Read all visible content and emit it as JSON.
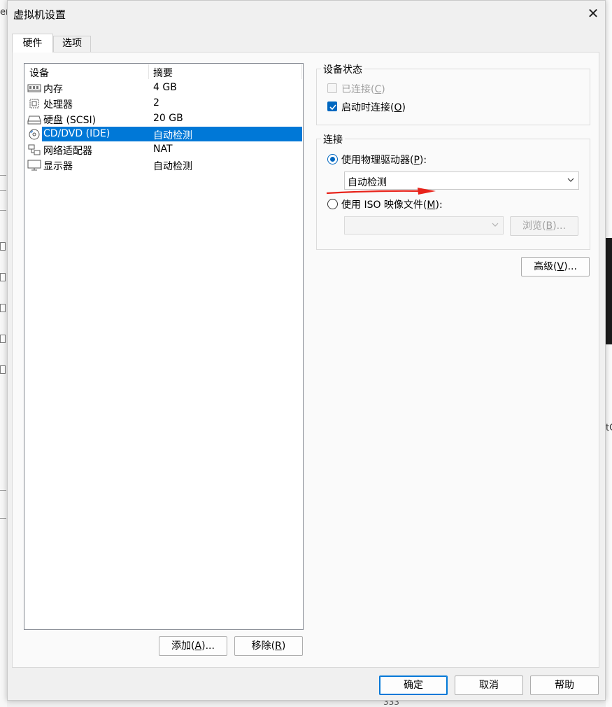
{
  "window": {
    "title": "虚拟机设置",
    "close_glyph": "✕"
  },
  "background": {
    "peek_top": "er",
    "peek_mid": "tC",
    "peek_bottom": "333"
  },
  "tabs": [
    {
      "label": "硬件",
      "active": true
    },
    {
      "label": "选项",
      "active": false
    }
  ],
  "device_list": {
    "columns": [
      "设备",
      "摘要"
    ],
    "rows": [
      {
        "icon": "memory-icon",
        "name": "内存",
        "summary": "4 GB",
        "selected": false
      },
      {
        "icon": "processor-icon",
        "name": "处理器",
        "summary": "2",
        "selected": false
      },
      {
        "icon": "hard-disk-icon",
        "name": "硬盘 (SCSI)",
        "summary": "20 GB",
        "selected": false
      },
      {
        "icon": "cd-dvd-icon",
        "name": "CD/DVD (IDE)",
        "summary": "自动检测",
        "selected": true
      },
      {
        "icon": "network-adapter-icon",
        "name": "网络适配器",
        "summary": "NAT",
        "selected": false
      },
      {
        "icon": "display-icon",
        "name": "显示器",
        "summary": "自动检测",
        "selected": false
      }
    ]
  },
  "list_buttons": {
    "add": {
      "label": "添加(",
      "key": "A",
      "suffix": ")..."
    },
    "remove": {
      "label": "移除(",
      "key": "R",
      "suffix": ")"
    }
  },
  "device_status": {
    "title": "设备状态",
    "connected": {
      "label": "已连接(",
      "key": "C",
      "suffix": ")",
      "checked": false,
      "enabled": false
    },
    "connect_at_power_on": {
      "label": "启动时连接(",
      "key": "O",
      "suffix": ")",
      "checked": true,
      "enabled": true
    }
  },
  "connection": {
    "title": "连接",
    "physical_drive": {
      "label": "使用物理驱动器(",
      "key": "P",
      "suffix": "):",
      "selected": true,
      "value": "自动检测"
    },
    "iso_image": {
      "label": "使用 ISO 映像文件(",
      "key": "M",
      "suffix": "):",
      "selected": false,
      "value": ""
    },
    "browse": {
      "label": "浏览(",
      "key": "B",
      "suffix": ")...",
      "enabled": false
    }
  },
  "advanced": {
    "label": "高级(",
    "key": "V",
    "suffix": ")..."
  },
  "footer": {
    "ok": "确定",
    "cancel": "取消",
    "help": "帮助"
  },
  "colors": {
    "accent": "#0078d7",
    "annotation_arrow": "#e8231a"
  }
}
